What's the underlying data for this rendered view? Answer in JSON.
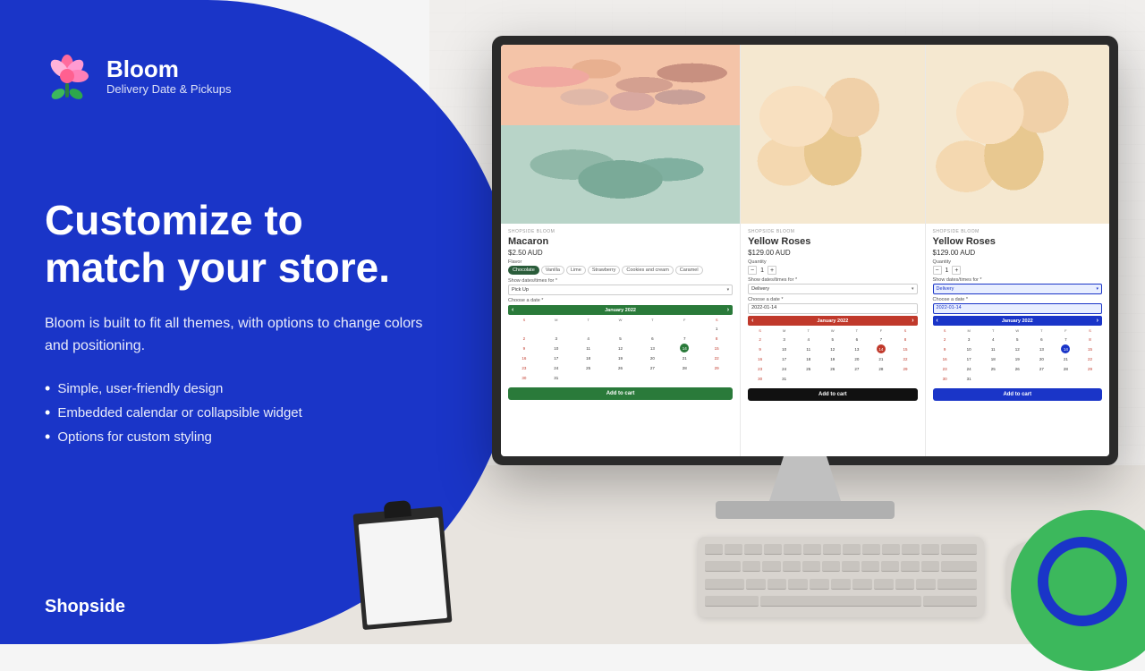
{
  "logo": {
    "title": "Bloom",
    "subtitle": "Delivery Date & Pickups"
  },
  "hero": {
    "headline": "Customize to match your store.",
    "body": "Bloom is built to fit all themes, with options to change colors and positioning.",
    "bullets": [
      "Simple, user-friendly design",
      "Embedded calendar or collapsible widget",
      "Options for custom styling"
    ]
  },
  "branding": {
    "shopside": "Shopside"
  },
  "product_1": {
    "brand": "SHOPSIDE BLOOM",
    "name": "Macaron",
    "price": "$2.50 AUD",
    "flavor_label": "Flavor",
    "flavors": [
      "Chocolate",
      "Vanilla",
      "Lime",
      "Strawberry",
      "Cookies and cream",
      "Caramel"
    ],
    "active_flavor": "Chocolate",
    "datetime_label": "Show dates/times for *",
    "pickup_option": "Pick Up",
    "date_label": "Choose a date *",
    "calendar_month": "January 2022",
    "add_to_cart": "Add to cart"
  },
  "product_2": {
    "brand": "SHOPSIDE BLOOM",
    "name": "Yellow Roses",
    "price": "$129.00 AUD",
    "qty_label": "Quantity",
    "qty_minus": "−",
    "qty_value": "1",
    "qty_plus": "+",
    "datetime_label": "Show dates/times for *",
    "delivery_option": "Delivery",
    "date_label": "Choose a date *",
    "date_value": "2022-01-14",
    "calendar_month": "January 2022",
    "add_to_cart": "Add to cart"
  },
  "product_3": {
    "brand": "SHOPSIDE BLOOM",
    "name": "Yellow Roses",
    "price": "$129.00 AUD",
    "qty_label": "Quantity",
    "qty_minus": "−",
    "qty_value": "1",
    "qty_plus": "+",
    "datetime_label": "Show dates/times for *",
    "delivery_option": "Delivery",
    "date_label": "Choose a date *",
    "date_value": "2022-01-14",
    "calendar_month": "January 2022",
    "add_to_cart": "Add to cart"
  },
  "colors": {
    "blue": "#1a35c8",
    "green": "#2a7a3a",
    "red": "#c0392b"
  }
}
